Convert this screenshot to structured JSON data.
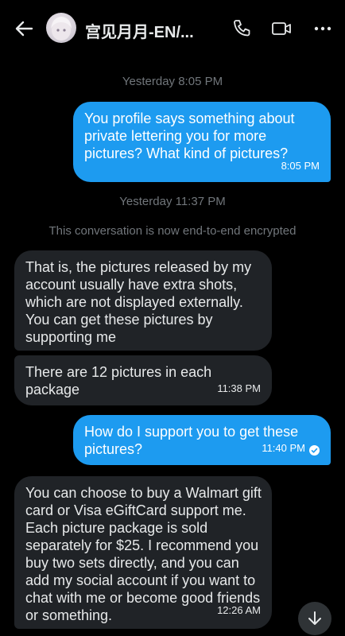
{
  "header": {
    "title": "宫见月月-EN/...",
    "back_icon": "arrow-left-icon",
    "call_icon": "phone-icon",
    "video_icon": "video-camera-icon",
    "more_icon": "more-dots-icon"
  },
  "timestamps": {
    "first": "Yesterday 8:05 PM",
    "second": "Yesterday 11:37 PM"
  },
  "encryption_note": "This conversation is now end-to-end encrypted",
  "messages": [
    {
      "text": "You profile says something about private lettering you for more pictures? What kind of pictures?",
      "time": "8:05 PM",
      "direction": "outgoing"
    },
    {
      "text": "That is, the pictures released by my account usually have extra shots, which are not displayed externally. You can get these pictures by supporting me",
      "time": "",
      "direction": "incoming"
    },
    {
      "text": "There are 12 pictures in each package",
      "time": "11:38 PM",
      "direction": "incoming"
    },
    {
      "text": "How do I support you to get these pictures?",
      "time": "11:40 PM",
      "direction": "outgoing",
      "status_icon": "sent-check-icon"
    },
    {
      "text": "You can choose to buy a Walmart gift card or Visa eGiftCard support me. Each picture package is sold separately for $25. I recommend you buy two sets directly, and you can add my social account if you want to chat with me or become good friends or something.",
      "time": "12:26 AM",
      "direction": "incoming"
    }
  ],
  "scroll_button_icon": "arrow-down-icon",
  "colors": {
    "background": "#000000",
    "outgoing_bubble": "#1d9bf0",
    "incoming_bubble": "#202327",
    "muted_text": "#71767b"
  }
}
